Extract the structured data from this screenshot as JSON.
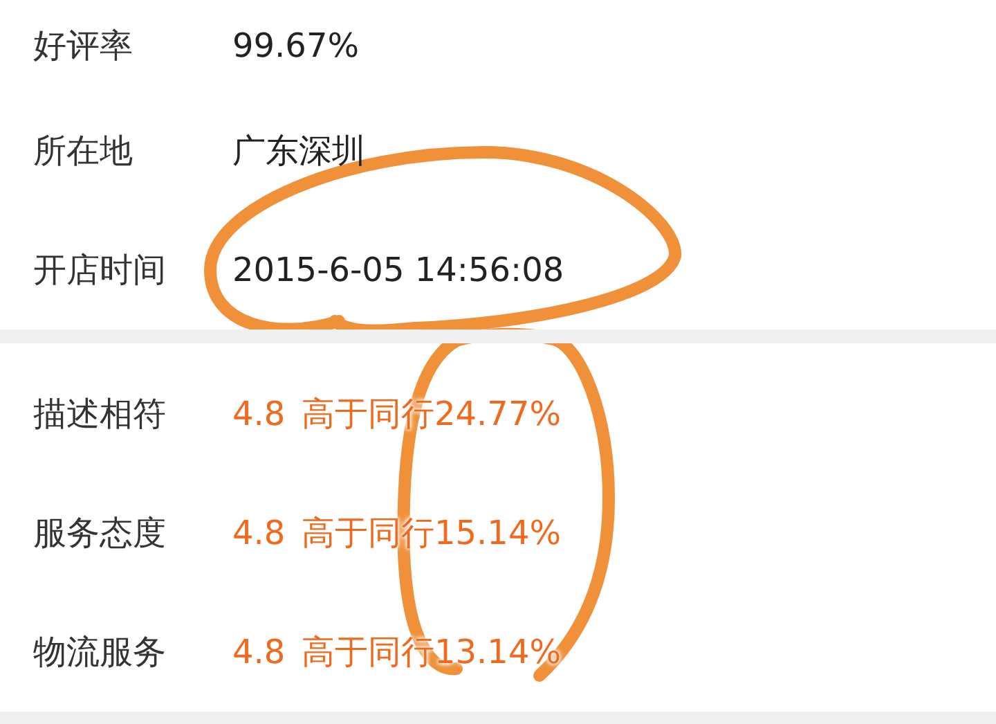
{
  "shop_info": [
    {
      "label": "好评率",
      "value": "99.67%"
    },
    {
      "label": "所在地",
      "value": "广东深圳"
    },
    {
      "label": "开店时间",
      "value": "2015-6-05 14:56:08"
    }
  ],
  "ratings": [
    {
      "label": "描述相符",
      "score": "4.8",
      "comparison": "高于同行24.77%"
    },
    {
      "label": "服务态度",
      "score": "4.8",
      "comparison": "高于同行15.14%"
    },
    {
      "label": "物流服务",
      "score": "4.8",
      "comparison": "高于同行13.14%"
    }
  ]
}
